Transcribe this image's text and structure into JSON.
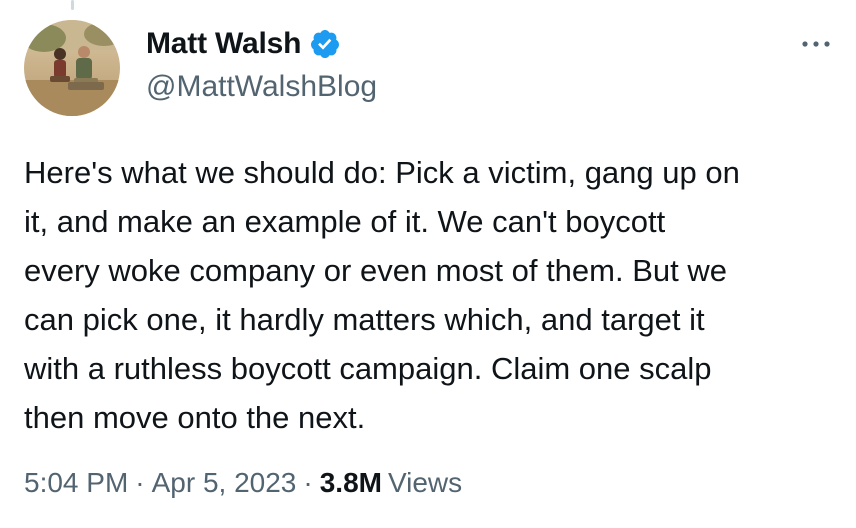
{
  "author": {
    "name": "Matt Walsh",
    "handle": "@MattWalshBlog",
    "verified_icon": "verified-badge-icon",
    "avatar_icon": "profile-photo"
  },
  "tweet": {
    "text": "Here's what we should do: Pick a victim, gang up on\nit, and make an example of it. We can't boycott\nevery woke company or even most of them. But we\ncan pick one, it hardly matters which, and target it\nwith a ruthless boycott campaign. Claim one scalp\nthen move onto the next."
  },
  "meta": {
    "time": "5:04 PM",
    "separator": "·",
    "date": "Apr 5, 2023",
    "views_count": "3.8M",
    "views_label": "Views"
  },
  "menu": {
    "more_icon": "more-horizontal-icon"
  },
  "colors": {
    "verified": "#1d9bf0",
    "text": "#0f1419",
    "secondary": "#536471"
  }
}
